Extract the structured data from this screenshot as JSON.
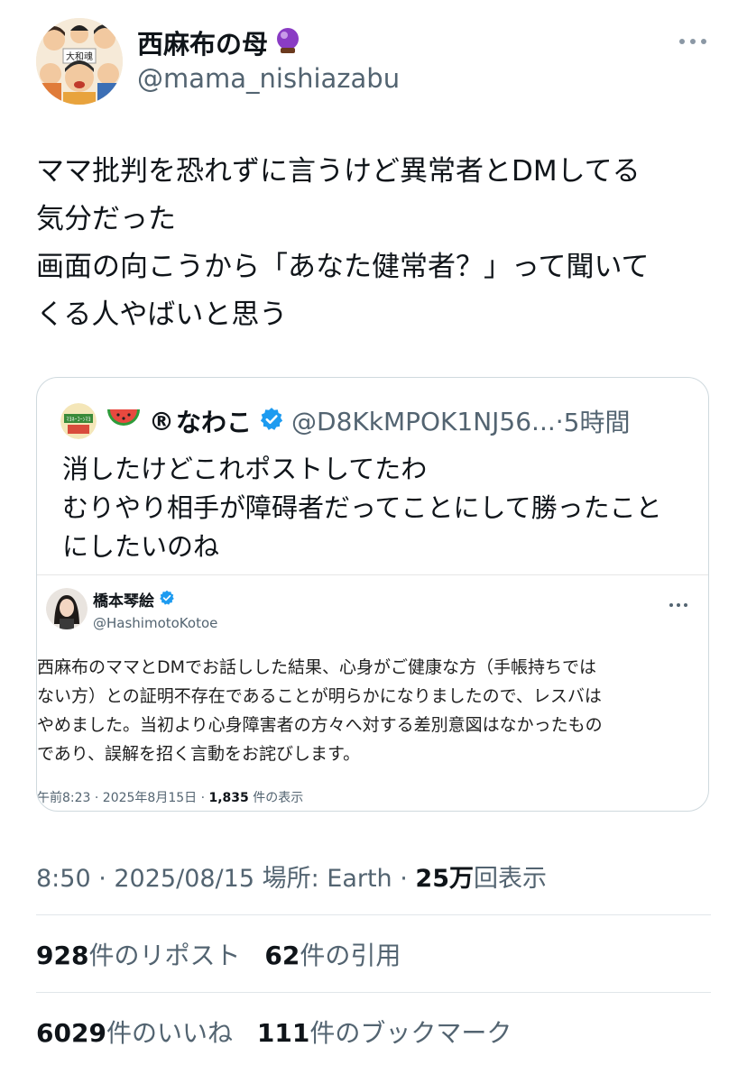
{
  "author": {
    "display_name": "西麻布の母",
    "handle": "@mama_nishiazabu",
    "emoji": "crystal-ball-icon",
    "avatar_sign_text": "大和魂"
  },
  "tweet": {
    "text": "ママ批判を恐れずに言うけど異常者とDMしてる\n気分だった\n画面の向こうから「あなた健常者？」って聞いて\nくる人やばいと思う"
  },
  "quoted": {
    "badge": "®",
    "name": "なわこ",
    "handle": "@D8KkMPOK1NJ56...",
    "separator": "·",
    "time": "5時間",
    "text": "消したけどこれポストしてたわ\nむりやり相手が障碍者だってことにして勝ったこと\nにしたいのね",
    "avatar_text": "ﾏﾖﾈｰｺｰﾝﾏﾖ"
  },
  "embedded": {
    "name": "橋本琴絵",
    "handle": "@HashimotoKotoe",
    "text": "西麻布のママとDMでお話しした結果、心身がご健康な方（手帳持ちでは\nない方）との証明不存在であることが明らかになりましたので、レスバは\nやめました。当初より心身障害者の方々へ対する差別意図はなかったもの\nであり、誤解を招く言動をお詫びします。",
    "meta_time": "午前8:23 · 2025年8月15日 · ",
    "meta_views": "1,835",
    "meta_views_label": " 件の表示"
  },
  "timestamp": {
    "text": "8:50 · 2025/08/15 場所: Earth · ",
    "views": "25万",
    "views_label": "回表示"
  },
  "stats": {
    "reposts": "928",
    "reposts_label": "件のリポスト",
    "quotes": "62",
    "quotes_label": "件の引用",
    "likes": "6029",
    "likes_label": "件のいいね",
    "bookmarks": "111",
    "bookmarks_label": "件のブックマーク"
  },
  "colors": {
    "verified": "#1d9bf0",
    "secondary_text": "#536471",
    "border": "#cfd9de",
    "crystal_ball": "#8a3cc4"
  }
}
